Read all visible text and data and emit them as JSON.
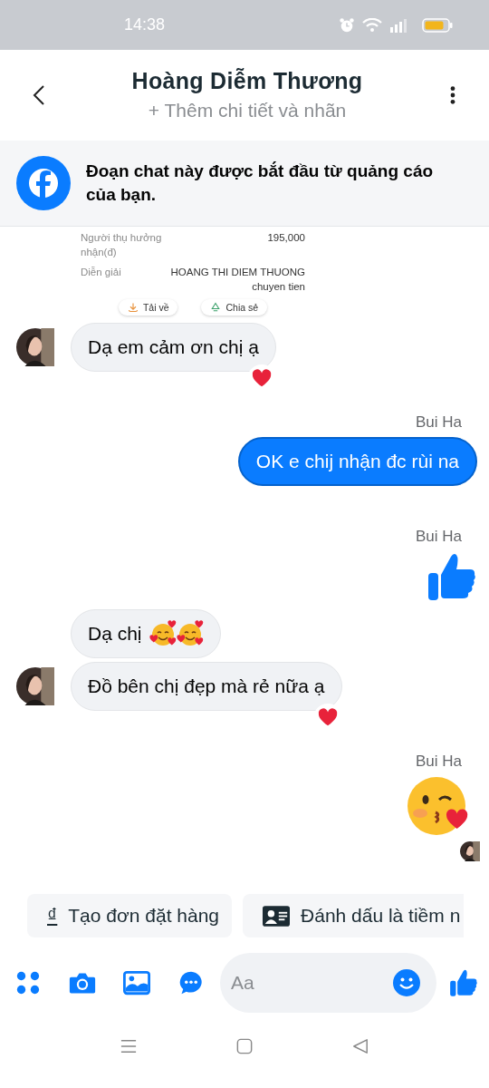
{
  "status_bar": {
    "time": "14:38"
  },
  "header": {
    "title": "Hoàng Diễm Thương",
    "subtitle": "+ Thêm chi tiết và nhãn"
  },
  "banner": {
    "text": "Đoạn chat này được bắt đầu từ quảng cáo của bạn."
  },
  "receipt": {
    "rows": [
      {
        "label": "Người thụ hưởng nhận(đ)",
        "value": "195,000"
      },
      {
        "label": "Diễn giải",
        "value": "HOANG THI DIEM THUONG chuyen tien"
      }
    ],
    "actions": [
      {
        "kind": "download",
        "label": "Tải về"
      },
      {
        "kind": "share",
        "label": "Chia sẻ"
      }
    ]
  },
  "messages": [
    {
      "kind": "received",
      "parts": [
        {
          "kind": "text",
          "text": "Dạ em cảm ơn chị ạ"
        }
      ],
      "avatar": true,
      "reacted": true
    },
    {
      "kind": "sender",
      "text": "Bui Ha"
    },
    {
      "kind": "sent",
      "parts": [
        {
          "kind": "text",
          "text": "OK e chij nhận đc rùi na"
        }
      ]
    },
    {
      "kind": "sender",
      "text": "Bui Ha"
    },
    {
      "kind": "like"
    },
    {
      "kind": "received",
      "parts": [
        {
          "kind": "text",
          "text": "Dạ chị"
        },
        {
          "kind": "emoji"
        },
        {
          "kind": "emoji"
        }
      ],
      "avatar": false,
      "reacted": false
    },
    {
      "kind": "received",
      "parts": [
        {
          "kind": "text",
          "text": "Đồ bên chị đẹp mà rẻ nữa ạ"
        }
      ],
      "avatar": true,
      "reacted": true
    },
    {
      "kind": "sender",
      "text": "Bui Ha"
    },
    {
      "kind": "kiss",
      "seen": true
    }
  ],
  "quick_actions": [
    {
      "kind": "order",
      "icon": "₫",
      "label": "Tạo đơn đặt hàng"
    },
    {
      "kind": "lead",
      "label": "Đánh dấu là tiềm n"
    }
  ],
  "composer": {
    "placeholder": "Aa"
  }
}
